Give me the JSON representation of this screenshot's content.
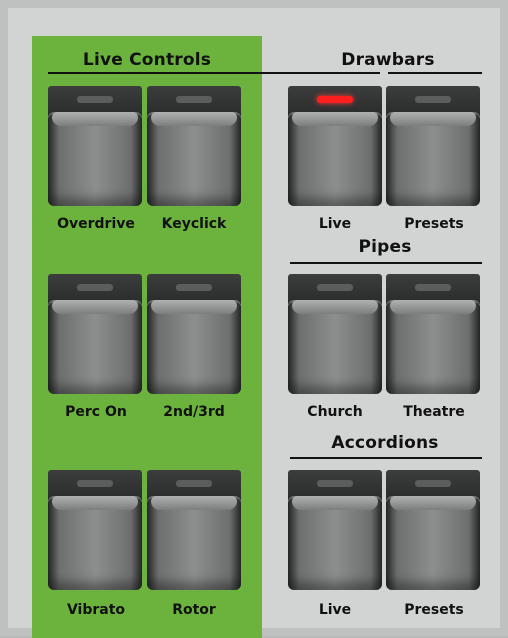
{
  "sections": {
    "live_controls": "Live Controls",
    "drawbars": "Drawbars",
    "pipes": "Pipes",
    "accordions": "Accordions"
  },
  "buttons": {
    "overdrive": "Overdrive",
    "keyclick": "Keyclick",
    "perc_on": "Perc On",
    "second_third": "2nd/3rd",
    "vibrato": "Vibrato",
    "rotor": "Rotor",
    "drawbars_live": "Live",
    "drawbars_presets": "Presets",
    "church": "Church",
    "theatre": "Theatre",
    "accordions_live": "Live",
    "accordions_presets": "Presets"
  },
  "colors": {
    "live_controls_bg": "#6cb33e",
    "led_active": "#ff1e1e",
    "led_inactive": "#5b5d5c"
  },
  "active_led": "drawbars_live"
}
